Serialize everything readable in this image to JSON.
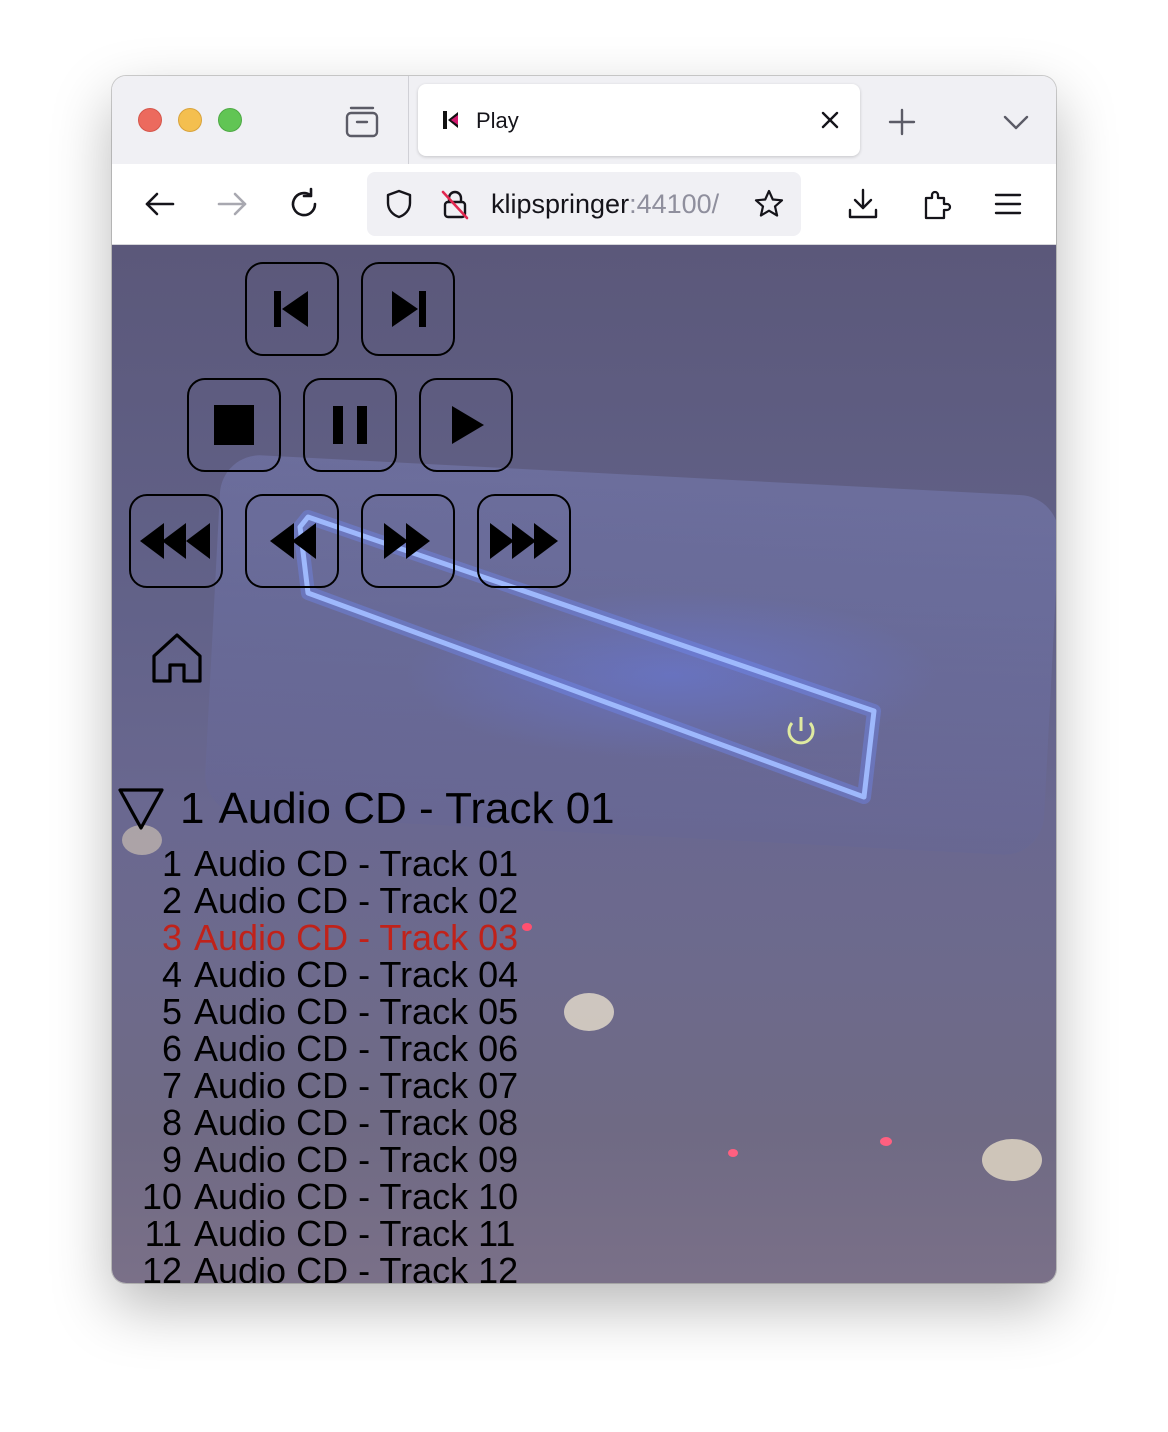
{
  "browser": {
    "tab_title": "Play",
    "url_host": "klipspringer",
    "url_port": ":44100/",
    "icons": {
      "tabs_overview": "tabs-overview-icon",
      "close": "close-icon",
      "new_tab": "plus-icon",
      "tab_list": "chevron-down-icon",
      "back": "arrow-left-icon",
      "forward": "arrow-right-icon",
      "reload": "reload-icon",
      "shield": "shield-icon",
      "lock": "insecure-lock-icon",
      "bookmark": "star-icon",
      "downloads": "download-icon",
      "extensions": "puzzle-icon",
      "menu": "hamburger-menu-icon"
    }
  },
  "player": {
    "controls": [
      {
        "name": "previous-track-button",
        "icon": "skip-back-icon"
      },
      {
        "name": "next-track-button",
        "icon": "skip-forward-icon"
      },
      {
        "name": "stop-button",
        "icon": "stop-icon"
      },
      {
        "name": "pause-button",
        "icon": "pause-icon"
      },
      {
        "name": "play-button",
        "icon": "play-icon"
      },
      {
        "name": "fast-rewind-button",
        "icon": "triple-rewind-icon"
      },
      {
        "name": "rewind-button",
        "icon": "rewind-icon"
      },
      {
        "name": "fast-forward-button",
        "icon": "fast-forward-icon"
      },
      {
        "name": "fastest-forward-button",
        "icon": "triple-forward-icon"
      }
    ],
    "home_icon": "home-icon",
    "current_track": {
      "number": "1",
      "title": "Audio CD - Track 01"
    },
    "active_color": "#c0221a",
    "tracks": [
      {
        "number": "1",
        "title": "Audio CD - Track 01"
      },
      {
        "number": "2",
        "title": "Audio CD - Track 02"
      },
      {
        "number": "3",
        "title": "Audio CD - Track 03",
        "active": true
      },
      {
        "number": "4",
        "title": "Audio CD - Track 04"
      },
      {
        "number": "5",
        "title": "Audio CD - Track 05"
      },
      {
        "number": "6",
        "title": "Audio CD - Track 06"
      },
      {
        "number": "7",
        "title": "Audio CD - Track 07"
      },
      {
        "number": "8",
        "title": "Audio CD - Track 08"
      },
      {
        "number": "9",
        "title": "Audio CD - Track 09"
      },
      {
        "number": "10",
        "title": "Audio CD - Track 10"
      },
      {
        "number": "11",
        "title": "Audio CD - Track 11"
      },
      {
        "number": "12",
        "title": "Audio CD - Track 12"
      }
    ]
  }
}
